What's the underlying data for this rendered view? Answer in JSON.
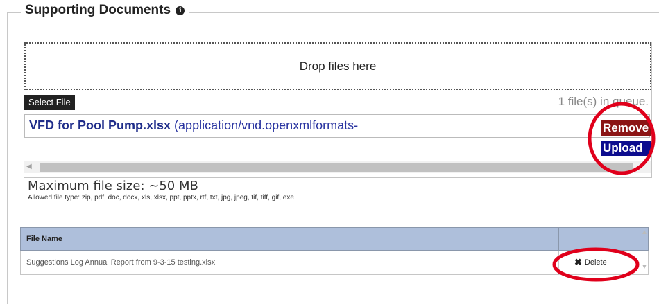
{
  "section": {
    "title": "Supporting Documents",
    "info_icon_glyph": "i"
  },
  "uploader": {
    "drop_text": "Drop files here",
    "select_button": "Select File",
    "queue_status": "1 file(s) in queue.",
    "queued_file": {
      "name": "VFD for Pool Pump.xlsx",
      "type": "(application/vnd.openxmlformats-",
      "remove_label": "Remove",
      "upload_label": "Upload"
    },
    "scroll_left_arrow": "◀"
  },
  "limits": {
    "max_size": "Maximum file size: ~50 MB",
    "allowed_types": "Allowed file type: zip, pdf, doc, docx, xls, xlsx, ppt, pptx, rtf, txt, jpg, jpeg, tif, tiff, gif, exe"
  },
  "files_table": {
    "headers": [
      "File Name",
      ""
    ],
    "rows": [
      {
        "name": "Suggestions Log Annual Report from 9-3-15 testing.xlsx",
        "action": "Delete"
      }
    ]
  },
  "annotations": {
    "circle_color": "#e0001b"
  },
  "icons": {
    "info": "info-icon",
    "delete": "close-icon",
    "scroll_up": "chevron-up-icon",
    "scroll_down": "chevron-down-icon"
  }
}
